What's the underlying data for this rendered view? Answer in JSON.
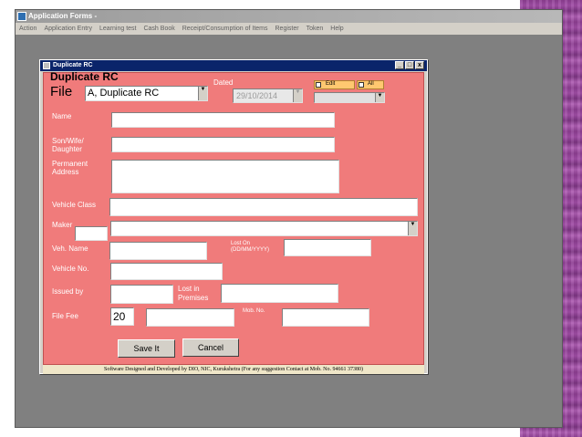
{
  "app": {
    "title": "Application Forms -",
    "menu": [
      "Action",
      "Application Entry",
      "Learning test",
      "Cash Book",
      "Receipt/Consumption of Items",
      "Register",
      "Token",
      "Help"
    ]
  },
  "form": {
    "title": "Duplicate RC",
    "heading": "Duplicate RC",
    "file_label": "File",
    "file_value": "A, Duplicate RC",
    "dated_label": "Dated",
    "dated_value": "29/10/2014",
    "edit_label": "Edit",
    "all_label": "All",
    "name_label": "Name",
    "relation_label": "Son/Wife/ Daughter",
    "address_label": "Permanent Address",
    "vehicle_class_label": "Vehicle Class",
    "maker_label": "Maker",
    "veh_name_label": "Veh. Name",
    "lost_on_label": "Lost On (DD/MM/YYYY)",
    "vehicle_no_label": "Vehicle No.",
    "issued_by_label": "Issued by",
    "lost_in_label": "Lost in Premises",
    "file_fee_label": "File Fee",
    "file_fee_value": "20",
    "mob_label": "Mob. No.",
    "save_label": "Save It",
    "cancel_label": "Cancel",
    "footer": "Software Designed and Developed by DIO, NIC, Kurukshetra (For any suggestion Contact at Mob. No. 94661 37380)"
  },
  "colors": {
    "panel": "#f07b7b",
    "titlebar": "#0a246a"
  },
  "icons": [
    "app-icon",
    "form-icon",
    "minimize-icon",
    "maximize-icon",
    "close-icon",
    "dropdown-arrow-icon"
  ]
}
